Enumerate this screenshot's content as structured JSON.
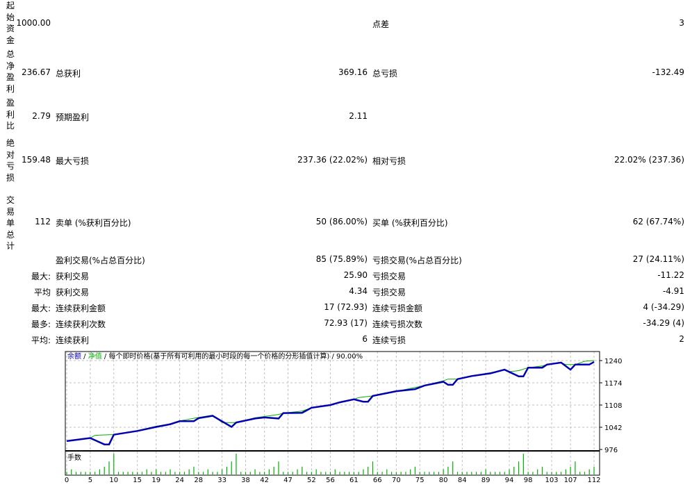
{
  "report": {
    "rows": [
      {
        "vlabel": "起始资金",
        "v1": "1000.00",
        "l2": "",
        "v2": "",
        "l3": "点差",
        "v3": "3"
      },
      {
        "vlabel": "总净盈利",
        "v1": "236.67",
        "l2": "总获利",
        "v2": "369.16",
        "l3": "总亏损",
        "v3": "-132.49"
      },
      {
        "vlabel": "盈利比",
        "v1": "2.79",
        "l2": "预期盈利",
        "v2": "2.11",
        "l3": "",
        "v3": ""
      },
      {
        "vlabel": "绝对亏损",
        "v1": "159.48",
        "l2": "最大亏损",
        "v2": "237.36 (22.02%)",
        "l3": "相对亏损",
        "v3": "22.02% (237.36)"
      },
      {
        "vlabel": "交易单总计",
        "v1": "112",
        "l2": "卖单 (%获利百分比)",
        "v2": "50 (86.00%)",
        "l3": "买单 (%获利百分比)",
        "v3": "62 (67.74%)"
      },
      {
        "prefix": "",
        "l2": "盈利交易(%占总百分比)",
        "v2": "85 (75.89%)",
        "l3": "亏损交易(%占总百分比)",
        "v3": "27 (24.11%)"
      },
      {
        "prefix": "最大:",
        "l2": "获利交易",
        "v2": "25.90",
        "l3": "亏损交易",
        "v3": "-11.22"
      },
      {
        "prefix": "平均",
        "l2": "获利交易",
        "v2": "4.34",
        "l3": "亏损交易",
        "v3": "-4.91"
      },
      {
        "prefix": "最大:",
        "l2": "连续获利金额",
        "v2": "17 (72.93)",
        "l3": "连续亏损金额",
        "v3": "4 (-34.29)"
      },
      {
        "prefix": "最多:",
        "l2": "连续获利次数",
        "v2": "72.93 (17)",
        "l3": "连续亏损次数",
        "v3": "-34.29 (4)"
      },
      {
        "prefix": "平均:",
        "l2": "连续获利",
        "v2": "6",
        "l3": "连续亏损",
        "v3": "2"
      }
    ]
  },
  "chart_data": {
    "type": "line",
    "title_parts": {
      "balance": "余额",
      "sep1": " / ",
      "equity": "净值",
      "sep2": " / ",
      "model": "每个即时价格(基于所有可利用的最小时段的每一个价格的分形插值计算)",
      "sep3": " / ",
      "quality": "90.00%"
    },
    "volume_label": "手数",
    "xlim": [
      0,
      112
    ],
    "ylim": [
      976,
      1240
    ],
    "yticks": [
      976,
      1042,
      1108,
      1174,
      1240
    ],
    "xticks": [
      0,
      5,
      10,
      15,
      19,
      24,
      28,
      33,
      38,
      42,
      47,
      52,
      56,
      61,
      66,
      70,
      75,
      80,
      84,
      89,
      94,
      98,
      103,
      107,
      112
    ],
    "colors": {
      "balance": "#0000b0",
      "equity": "#00b000",
      "volume": "#00b000",
      "grid": "#c0c0c0"
    },
    "balance": [
      [
        0,
        1001
      ],
      [
        5,
        1010
      ],
      [
        8,
        991
      ],
      [
        9,
        991
      ],
      [
        10,
        1020
      ],
      [
        15,
        1031
      ],
      [
        19,
        1043
      ],
      [
        22,
        1051
      ],
      [
        24,
        1060
      ],
      [
        27,
        1060
      ],
      [
        28,
        1069
      ],
      [
        31,
        1076
      ],
      [
        35,
        1043
      ],
      [
        36,
        1056
      ],
      [
        40,
        1068
      ],
      [
        42,
        1071
      ],
      [
        45,
        1068
      ],
      [
        46,
        1084
      ],
      [
        50,
        1085
      ],
      [
        52,
        1100
      ],
      [
        56,
        1108
      ],
      [
        58,
        1116
      ],
      [
        61,
        1125
      ],
      [
        63,
        1118
      ],
      [
        64,
        1118
      ],
      [
        65,
        1135
      ],
      [
        70,
        1149
      ],
      [
        74,
        1155
      ],
      [
        76,
        1166
      ],
      [
        80,
        1177
      ],
      [
        81,
        1168
      ],
      [
        82,
        1168
      ],
      [
        83,
        1185
      ],
      [
        86,
        1194
      ],
      [
        90,
        1202
      ],
      [
        93,
        1213
      ],
      [
        96,
        1193
      ],
      [
        97,
        1193
      ],
      [
        98,
        1219
      ],
      [
        101,
        1219
      ],
      [
        102,
        1228
      ],
      [
        105,
        1234
      ],
      [
        107,
        1213
      ],
      [
        108,
        1228
      ],
      [
        111,
        1228
      ],
      [
        112,
        1236
      ]
    ],
    "equity": [
      [
        0,
        1001
      ],
      [
        1,
        1004
      ],
      [
        5,
        1010
      ],
      [
        6,
        1018
      ],
      [
        9,
        1020
      ],
      [
        10,
        1020
      ],
      [
        15,
        1031
      ],
      [
        19,
        1045
      ],
      [
        22,
        1051
      ],
      [
        24,
        1061
      ],
      [
        28,
        1071
      ],
      [
        31,
        1078
      ],
      [
        33,
        1056
      ],
      [
        36,
        1056
      ],
      [
        40,
        1070
      ],
      [
        45,
        1080
      ],
      [
        46,
        1084
      ],
      [
        50,
        1090
      ],
      [
        52,
        1100
      ],
      [
        56,
        1108
      ],
      [
        58,
        1117
      ],
      [
        61,
        1125
      ],
      [
        62,
        1130
      ],
      [
        65,
        1135
      ],
      [
        68,
        1143
      ],
      [
        74,
        1160
      ],
      [
        76,
        1166
      ],
      [
        80,
        1180
      ],
      [
        81,
        1185
      ],
      [
        83,
        1185
      ],
      [
        86,
        1194
      ],
      [
        90,
        1204
      ],
      [
        93,
        1213
      ],
      [
        94,
        1207
      ],
      [
        96,
        1210
      ],
      [
        98,
        1219
      ],
      [
        101,
        1224
      ],
      [
        102,
        1228
      ],
      [
        105,
        1234
      ],
      [
        106,
        1228
      ],
      [
        108,
        1228
      ],
      [
        110,
        1238
      ],
      [
        112,
        1240
      ]
    ],
    "volume": [
      1,
      2,
      1,
      1,
      1,
      1,
      1,
      2,
      3,
      5,
      8,
      1,
      1,
      1,
      1,
      1,
      1,
      2,
      1,
      2,
      1,
      1,
      2,
      1,
      1,
      1,
      2,
      3,
      1,
      1,
      2,
      1,
      1,
      2,
      3,
      5,
      8,
      1,
      1,
      1,
      2,
      1,
      1,
      2,
      3,
      5,
      1,
      1,
      1,
      2,
      3,
      1,
      1,
      2,
      1,
      1,
      1,
      2,
      1,
      1,
      1,
      1,
      1,
      2,
      3,
      5,
      1,
      1,
      2,
      1,
      1,
      1,
      1,
      2,
      3,
      1,
      1,
      1,
      1,
      1,
      2,
      3,
      5,
      1,
      1,
      1,
      1,
      1,
      1,
      2,
      1,
      1,
      1,
      1,
      2,
      3,
      5,
      8,
      1,
      1,
      2,
      3,
      1,
      1,
      1,
      1,
      2,
      3,
      5,
      1,
      1,
      2,
      3
    ]
  }
}
